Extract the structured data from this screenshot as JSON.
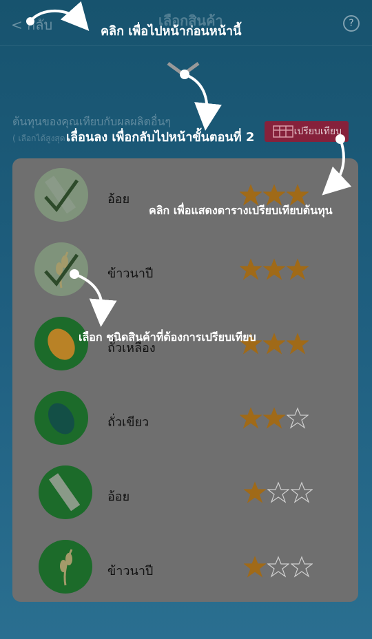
{
  "header": {
    "back_label": "< กลับ",
    "title": "เลือกสินค้า",
    "help_icon": "?"
  },
  "subheading": {
    "title": "ต้นทุนของคุณเทียบกับผลผลิตอื่นๆ",
    "hint": "( เลือกได้สูงสุด"
  },
  "compare_button": {
    "label": "เปรียบเทียบ",
    "icon": "grid-icon"
  },
  "crops": [
    {
      "name": "อ้อย",
      "rating": 3,
      "selected": true,
      "faded": true,
      "icon": "sugarcane-icon"
    },
    {
      "name": "ข้าวนาปี",
      "rating": 3,
      "selected": true,
      "faded": true,
      "icon": "rice-icon"
    },
    {
      "name": "ถั่วเหลือง",
      "rating": 3,
      "selected": false,
      "faded": false,
      "icon": "soybean-icon"
    },
    {
      "name": "ถั่วเขียว",
      "rating": 2,
      "selected": false,
      "faded": false,
      "icon": "mungbean-icon"
    },
    {
      "name": "อ้อย",
      "rating": 1,
      "selected": false,
      "faded": false,
      "icon": "sugarcane-icon"
    },
    {
      "name": "ข้าวนาปี",
      "rating": 1,
      "selected": false,
      "faded": false,
      "icon": "rice-icon"
    }
  ],
  "annotations": {
    "back_hint": "คลิก เพื่อไปหน้าก่อนหน้านี้",
    "scroll_hint": "เลื่อนลง เพื่อกลับไปหน้าขั้นตอนที่ 2",
    "compare_hint": "คลิก เพื่อแสดงตารางเปรียบเทียบต้นทุน",
    "select_hint": "เลือก ชนิดสินค้าที่ต้องการเปรียบเทียบ"
  },
  "colors": {
    "star": "#a06a18",
    "crop_green": "#1c6b2a",
    "crop_faded": "#7f937b",
    "panel": "#6f6f6f",
    "button": "#86213b"
  }
}
